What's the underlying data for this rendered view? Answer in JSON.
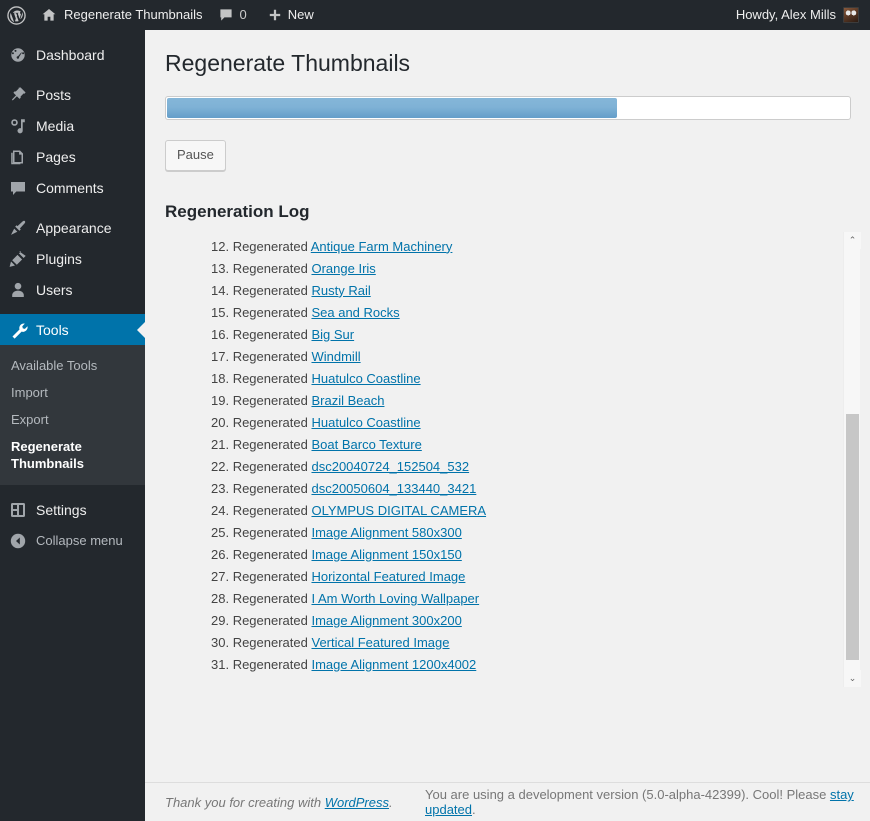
{
  "adminbar": {
    "wp_logo": "wordpress-logo",
    "site_name": "Regenerate Thumbnails",
    "comments_count": "0",
    "new_label": "New",
    "howdy": "Howdy, Alex Mills"
  },
  "sidebar": {
    "items": [
      {
        "label": "Dashboard",
        "icon": "dashboard-icon",
        "current": false
      },
      {
        "label": "Posts",
        "icon": "posts-pin-icon",
        "current": false
      },
      {
        "label": "Media",
        "icon": "media-icon",
        "current": false
      },
      {
        "label": "Pages",
        "icon": "pages-icon",
        "current": false
      },
      {
        "label": "Comments",
        "icon": "comments-icon",
        "current": false
      },
      {
        "label": "Appearance",
        "icon": "appearance-brush-icon",
        "current": false
      },
      {
        "label": "Plugins",
        "icon": "plugins-plug-icon",
        "current": false
      },
      {
        "label": "Users",
        "icon": "users-icon",
        "current": false
      },
      {
        "label": "Tools",
        "icon": "tools-wrench-icon",
        "current": true
      },
      {
        "label": "Settings",
        "icon": "settings-icon",
        "current": false
      }
    ],
    "submenu": [
      {
        "label": "Available Tools",
        "current": false
      },
      {
        "label": "Import",
        "current": false
      },
      {
        "label": "Export",
        "current": false
      },
      {
        "label": "Regenerate",
        "label2": "Thumbnails",
        "current": true
      }
    ],
    "collapse_label": "Collapse menu",
    "collapse_icon": "collapse-arrow-icon"
  },
  "main": {
    "page_title": "Regenerate Thumbnails",
    "progress_percent": 66,
    "pause_label": "Pause",
    "log_heading": "Regeneration Log",
    "log_items": [
      {
        "num": "12.",
        "prefix": "Regenerated",
        "link": "Antique Farm Machinery"
      },
      {
        "num": "13.",
        "prefix": "Regenerated",
        "link": "Orange Iris"
      },
      {
        "num": "14.",
        "prefix": "Regenerated",
        "link": "Rusty Rail"
      },
      {
        "num": "15.",
        "prefix": "Regenerated",
        "link": "Sea and Rocks"
      },
      {
        "num": "16.",
        "prefix": "Regenerated",
        "link": "Big Sur"
      },
      {
        "num": "17.",
        "prefix": "Regenerated",
        "link": "Windmill"
      },
      {
        "num": "18.",
        "prefix": "Regenerated",
        "link": "Huatulco Coastline"
      },
      {
        "num": "19.",
        "prefix": "Regenerated",
        "link": "Brazil Beach"
      },
      {
        "num": "20.",
        "prefix": "Regenerated",
        "link": "Huatulco Coastline"
      },
      {
        "num": "21.",
        "prefix": "Regenerated",
        "link": "Boat Barco Texture"
      },
      {
        "num": "22.",
        "prefix": "Regenerated",
        "link": "dsc20040724_152504_532"
      },
      {
        "num": "23.",
        "prefix": "Regenerated",
        "link": "dsc20050604_133440_3421"
      },
      {
        "num": "24.",
        "prefix": "Regenerated",
        "link": "OLYMPUS DIGITAL CAMERA"
      },
      {
        "num": "25.",
        "prefix": "Regenerated",
        "link": "Image Alignment 580x300"
      },
      {
        "num": "26.",
        "prefix": "Regenerated",
        "link": "Image Alignment 150x150"
      },
      {
        "num": "27.",
        "prefix": "Regenerated",
        "link": "Horizontal Featured Image"
      },
      {
        "num": "28.",
        "prefix": "Regenerated",
        "link": "I Am Worth Loving Wallpaper"
      },
      {
        "num": "29.",
        "prefix": "Regenerated",
        "link": "Image Alignment 300x200"
      },
      {
        "num": "30.",
        "prefix": "Regenerated",
        "link": "Vertical Featured Image"
      },
      {
        "num": "31.",
        "prefix": "Regenerated",
        "link": "Image Alignment 1200x4002"
      }
    ],
    "scrollbar": {
      "up_glyph": "⌃",
      "down_glyph": "⌄"
    }
  },
  "footer": {
    "thanks_prefix": "Thank you for creating with ",
    "thanks_link": "WordPress",
    "thanks_suffix": ".",
    "version_prefix": "You are using a development version (5.0-alpha-42399). Cool! Please ",
    "version_link": "stay updated",
    "version_suffix": "."
  },
  "colors": {
    "adminbar_bg": "#23282d",
    "sidebar_bg": "#23282d",
    "submenu_bg": "#32373c",
    "accent": "#0073aa",
    "content_bg": "#f1f1f1",
    "link": "#0073aa",
    "progress_fill": "#7fb2d6"
  }
}
